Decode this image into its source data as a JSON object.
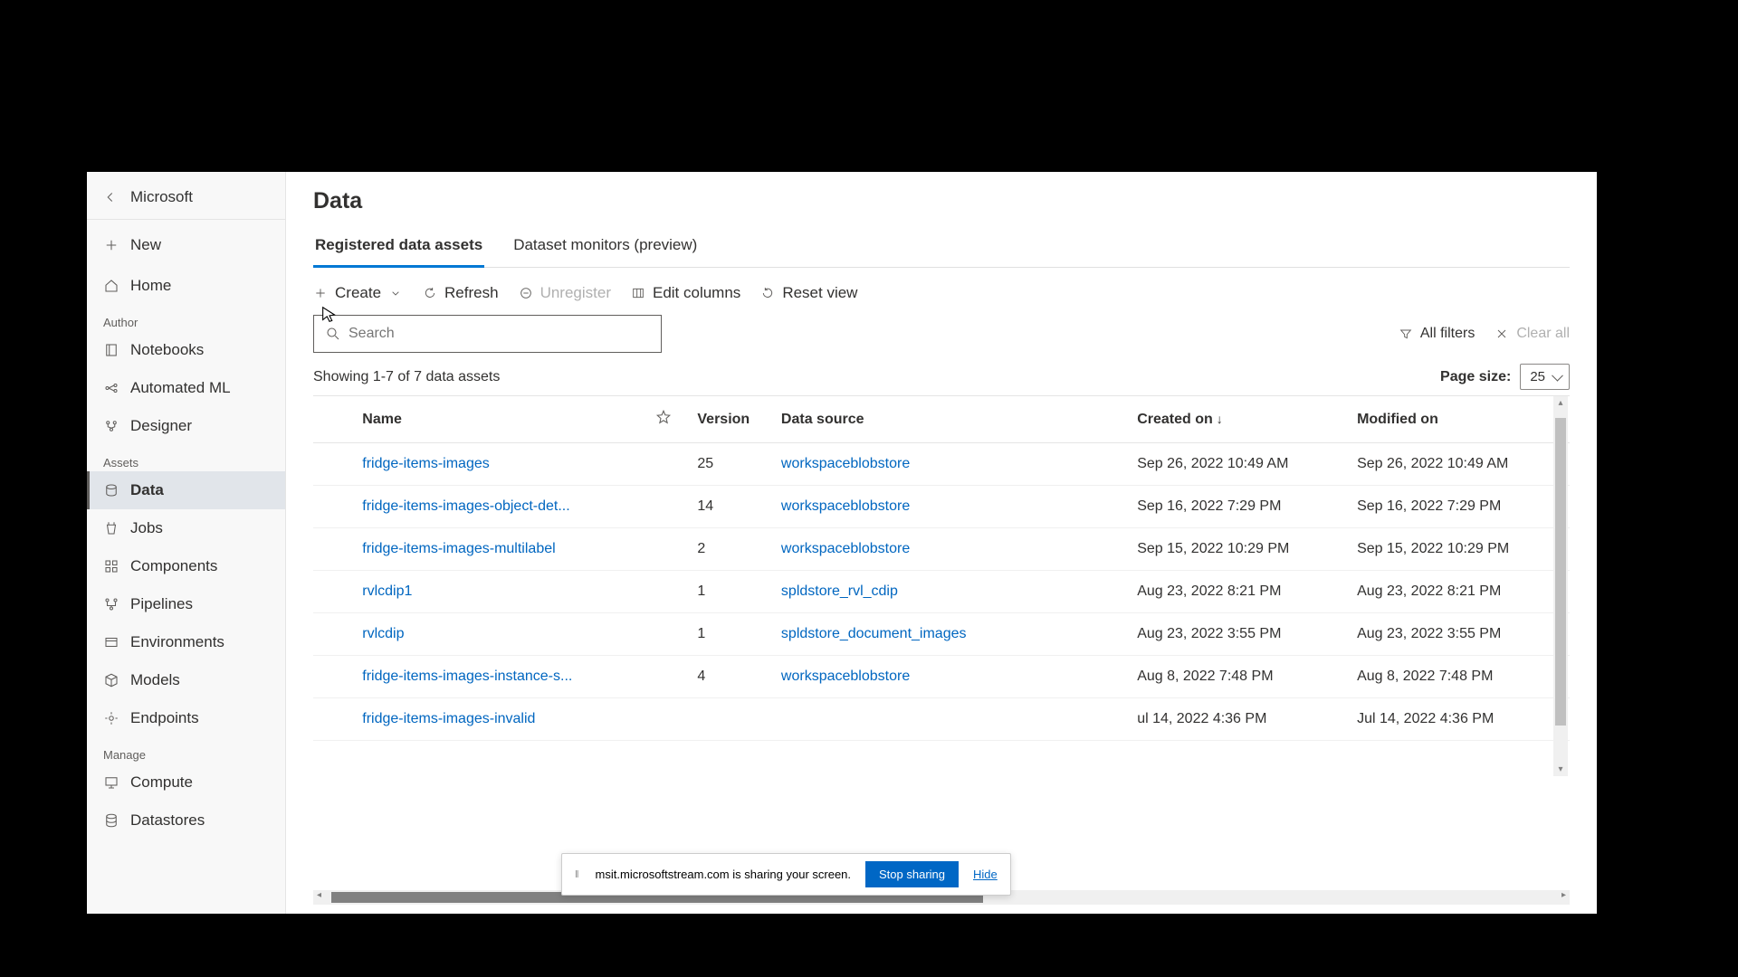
{
  "sidebar": {
    "org": "Microsoft",
    "new": "New",
    "items": {
      "home": "Home",
      "notebooks": "Notebooks",
      "automl": "Automated ML",
      "designer": "Designer",
      "data": "Data",
      "jobs": "Jobs",
      "components": "Components",
      "pipelines": "Pipelines",
      "environments": "Environments",
      "models": "Models",
      "endpoints": "Endpoints",
      "compute": "Compute",
      "datastores": "Datastores"
    },
    "sections": {
      "author": "Author",
      "assets": "Assets",
      "manage": "Manage"
    }
  },
  "page": {
    "title": "Data"
  },
  "tabs": {
    "registered": "Registered data assets",
    "monitors": "Dataset monitors (preview)"
  },
  "toolbar": {
    "create": "Create",
    "refresh": "Refresh",
    "unregister": "Unregister",
    "editcols": "Edit columns",
    "resetview": "Reset view"
  },
  "filters": {
    "search_placeholder": "Search",
    "all_filters": "All filters",
    "clear_all": "Clear all"
  },
  "status": {
    "showing": "Showing 1-7 of 7 data assets",
    "page_size_label": "Page size:",
    "page_size_value": "25"
  },
  "columns": {
    "name": "Name",
    "version": "Version",
    "datasource": "Data source",
    "created": "Created on",
    "modified": "Modified on"
  },
  "rows": [
    {
      "name": "fridge-items-images",
      "version": "25",
      "ds": "workspaceblobstore",
      "created": "Sep 26, 2022 10:49 AM",
      "modified": "Sep 26, 2022 10:49 AM"
    },
    {
      "name": "fridge-items-images-object-det...",
      "version": "14",
      "ds": "workspaceblobstore",
      "created": "Sep 16, 2022 7:29 PM",
      "modified": "Sep 16, 2022 7:29 PM"
    },
    {
      "name": "fridge-items-images-multilabel",
      "version": "2",
      "ds": "workspaceblobstore",
      "created": "Sep 15, 2022 10:29 PM",
      "modified": "Sep 15, 2022 10:29 PM"
    },
    {
      "name": "rvlcdip1",
      "version": "1",
      "ds": "spldstore_rvl_cdip",
      "created": "Aug 23, 2022 8:21 PM",
      "modified": "Aug 23, 2022 8:21 PM"
    },
    {
      "name": "rvlcdip",
      "version": "1",
      "ds": "spldstore_document_images",
      "created": "Aug 23, 2022 3:55 PM",
      "modified": "Aug 23, 2022 3:55 PM"
    },
    {
      "name": "fridge-items-images-instance-s...",
      "version": "4",
      "ds": "workspaceblobstore",
      "created": "Aug 8, 2022 7:48 PM",
      "modified": "Aug 8, 2022 7:48 PM"
    },
    {
      "name": "fridge-items-images-invalid",
      "version": "",
      "ds": "",
      "created": "ul 14, 2022 4:36 PM",
      "modified": "Jul 14, 2022 4:36 PM"
    }
  ],
  "share_bar": {
    "text": "msit.microsoftstream.com is sharing your screen.",
    "stop": "Stop sharing",
    "hide": "Hide"
  }
}
